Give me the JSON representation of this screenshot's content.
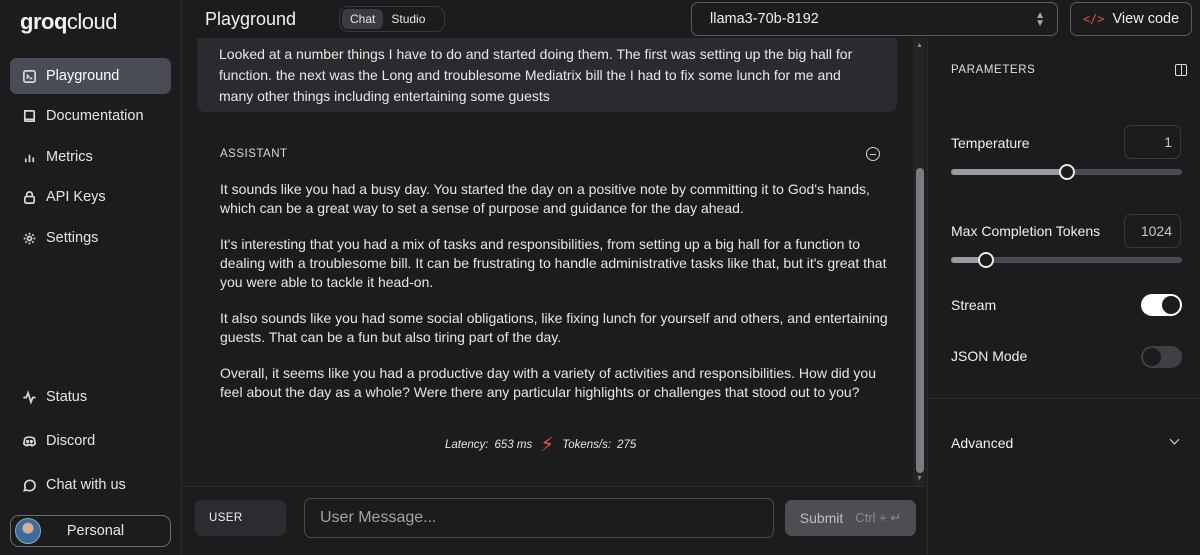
{
  "brand": {
    "logo_main": "groq",
    "logo_sub": "cloud"
  },
  "sidebar": {
    "items": [
      {
        "label": "Playground",
        "icon": "playground-icon",
        "active": true
      },
      {
        "label": "Documentation",
        "icon": "book-icon"
      },
      {
        "label": "Metrics",
        "icon": "bar-chart-icon"
      },
      {
        "label": "API Keys",
        "icon": "lock-icon"
      },
      {
        "label": "Settings",
        "icon": "gear-icon"
      }
    ],
    "bottom_items": [
      {
        "label": "Status",
        "icon": "activity-icon"
      },
      {
        "label": "Discord",
        "icon": "discord-icon"
      },
      {
        "label": "Chat with us",
        "icon": "chat-bubble-icon"
      }
    ],
    "account_label": "Personal"
  },
  "header": {
    "title": "Playground",
    "modes": [
      "Chat",
      "Studio"
    ],
    "active_mode": "Chat",
    "model": "llama3-70b-8192",
    "view_code_label": "View code"
  },
  "chat": {
    "user_message": "Looked at a number things I have to do and started doing them. The first was setting up the big hall for function. the next was the Long and troublesome Mediatrix bill the I had to fix some lunch for me and many other things including entertaining some guests",
    "assistant_label": "ASSISTANT",
    "assistant_paragraphs": [
      "It sounds like you had a busy day. You started the day on a positive note by committing it to God's hands, which can be a great way to set a sense of purpose and guidance for the day ahead.",
      "It's interesting that you had a mix of tasks and responsibilities, from setting up a big hall for a function to dealing with a troublesome bill. It can be frustrating to handle administrative tasks like that, but it's great that you were able to tackle it head-on.",
      "It also sounds like you had some social obligations, like fixing lunch for yourself and others, and entertaining guests. That can be a fun but also tiring part of the day.",
      "Overall, it seems like you had a productive day with a variety of activities and responsibilities. How did you feel about the day as a whole? Were there any particular highlights or challenges that stood out to you?"
    ],
    "latency_label": "Latency:",
    "latency_value": "653 ms",
    "tokens_label": "Tokens/s:",
    "tokens_value": "275"
  },
  "composer": {
    "role_label": "USER",
    "placeholder": "User Message...",
    "submit_label": "Submit",
    "shortcut": "Ctrl + ↵"
  },
  "params": {
    "title": "PARAMETERS",
    "temperature": {
      "label": "Temperature",
      "value": "1",
      "fraction": 0.5
    },
    "max_tokens": {
      "label": "Max Completion Tokens",
      "value": "1024",
      "fraction": 0.15
    },
    "stream": {
      "label": "Stream",
      "on": true
    },
    "json_mode": {
      "label": "JSON Mode",
      "on": false
    },
    "advanced_label": "Advanced"
  }
}
